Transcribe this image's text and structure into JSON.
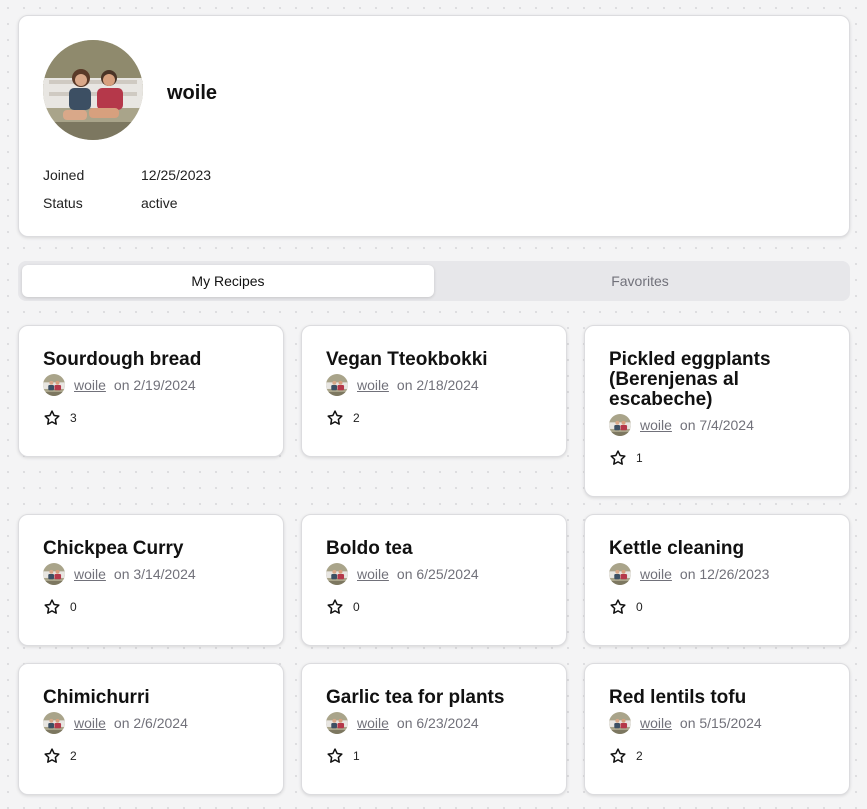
{
  "profile": {
    "username": "woile",
    "joined_label": "Joined",
    "joined_value": "12/25/2023",
    "status_label": "Status",
    "status_value": "active"
  },
  "tabs": [
    {
      "label": "My Recipes",
      "active": true
    },
    {
      "label": "Favorites",
      "active": false
    }
  ],
  "recipes": [
    {
      "title": "Sourdough bread",
      "author": "woile",
      "date": "on 2/19/2024",
      "stars": "3"
    },
    {
      "title": "Vegan Tteokbokki",
      "author": "woile",
      "date": "on 2/18/2024",
      "stars": "2"
    },
    {
      "title": "Pickled eggplants (Berenjenas al escabeche)",
      "author": "woile",
      "date": "on 7/4/2024",
      "stars": "1"
    },
    {
      "title": "Chickpea Curry",
      "author": "woile",
      "date": "on 3/14/2024",
      "stars": "0"
    },
    {
      "title": "Boldo tea",
      "author": "woile",
      "date": "on 6/25/2024",
      "stars": "0"
    },
    {
      "title": "Kettle cleaning",
      "author": "woile",
      "date": "on 12/26/2023",
      "stars": "0"
    },
    {
      "title": "Chimichurri",
      "author": "woile",
      "date": "on 2/6/2024",
      "stars": "2"
    },
    {
      "title": "Garlic tea for plants",
      "author": "woile",
      "date": "on 6/23/2024",
      "stars": "1"
    },
    {
      "title": "Red lentils tofu",
      "author": "woile",
      "date": "on 5/15/2024",
      "stars": "2"
    }
  ],
  "icons": {
    "star": "star-icon",
    "avatar": "avatar"
  },
  "colors": {
    "background": "#f4f4f5",
    "muted_text": "#71717a",
    "tab_bar": "#e7e7ea"
  }
}
